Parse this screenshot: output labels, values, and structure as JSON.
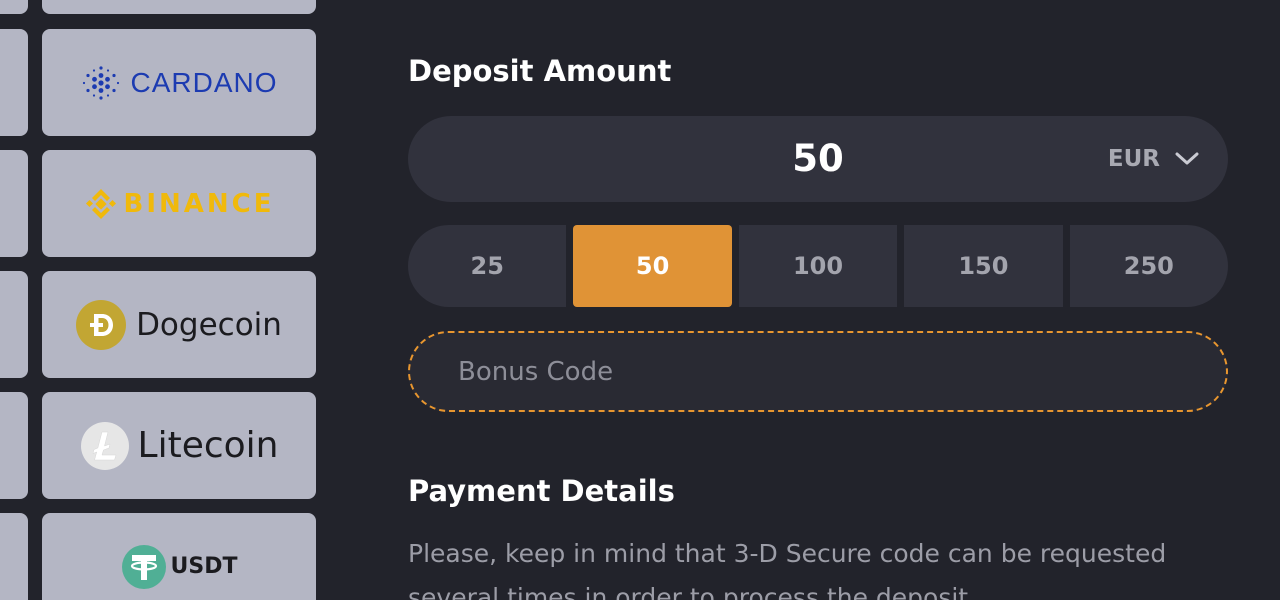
{
  "payment_methods": [
    {
      "name": "Cardano",
      "logo_text": "CARDANO",
      "icon": "cardano-icon",
      "color": "#1c3bb1"
    },
    {
      "name": "Binance",
      "logo_text": "BINANCE",
      "icon": "binance-icon",
      "color": "#f0b90b"
    },
    {
      "name": "Dogecoin",
      "logo_text": "Dogecoin",
      "icon": "dogecoin-icon",
      "color": "#c2a633"
    },
    {
      "name": "Litecoin",
      "logo_text": "Litecoin",
      "icon": "litecoin-icon",
      "color": "#bfbfbf"
    },
    {
      "name": "USDT",
      "logo_text": "USDT",
      "icon": "tether-icon",
      "color": "#50af95"
    }
  ],
  "deposit": {
    "title": "Deposit Amount",
    "amount": "50",
    "currency": "EUR",
    "presets": [
      "25",
      "50",
      "100",
      "150",
      "250"
    ],
    "selected_preset": "50",
    "bonus_placeholder": "Bonus Code",
    "accent_color": "#e09336"
  },
  "payment": {
    "title": "Payment Details",
    "text": "Please, keep in mind that 3-D Secure code can be requested several times in order to process the deposit"
  }
}
